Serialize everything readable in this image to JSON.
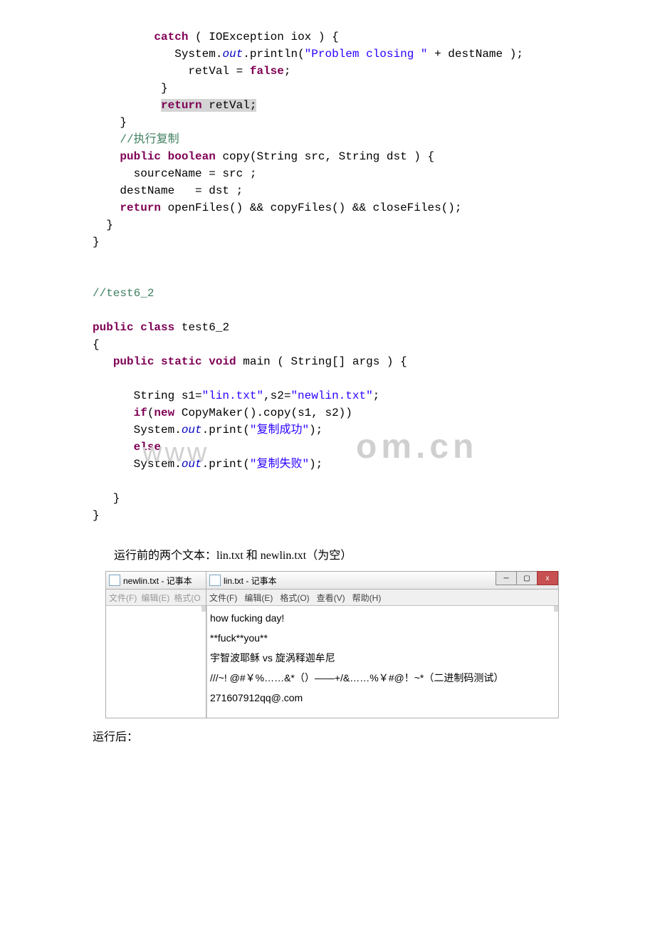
{
  "code1": {
    "l1a": "catch",
    "l1b": " ( IOException iox ) {",
    "l2a": "            System.",
    "l2b": "out",
    "l2c": ".println(",
    "l2d": "\"Problem closing \"",
    "l2e": " + destName );",
    "l3a": "              retVal = ",
    "l3b": "false",
    "l3c": ";",
    "l4": "          }",
    "l5a": "          ",
    "l5b": "return",
    "l5c": " retVal;",
    "l6": "    }",
    "l7": "    //执行复制",
    "l8a": "    ",
    "l8b": "public",
    "l8c": " ",
    "l8d": "boolean",
    "l8e": " copy(String src, String dst ) {",
    "l9": "      sourceName = src ;",
    "l10": "    destName   = dst ;",
    "l11a": "    ",
    "l11b": "return",
    "l11c": " openFiles() && copyFiles() && closeFiles();",
    "l12": "  }",
    "l13": "}"
  },
  "code2": {
    "l1": "//test6_2",
    "l2a": "public",
    "l2b": " ",
    "l2c": "class",
    "l2d": " test6_2",
    "l3": "{",
    "l4a": "   ",
    "l4b": "public",
    "l4c": " ",
    "l4d": "static",
    "l4e": " ",
    "l4f": "void",
    "l4g": " main ( String[] args ) {",
    "l5a": "      String s1=",
    "l5b": "\"lin.txt\"",
    "l5c": ",s2=",
    "l5d": "\"newlin.txt\"",
    "l5e": ";",
    "l6a": "      ",
    "l6b": "if",
    "l6c": "(",
    "l6d": "new",
    "l6e": " CopyMaker().copy(s1, s2))",
    "l7a": "      System.",
    "l7b": "out",
    "l7c": ".print(",
    "l7d": "\"复制成功\"",
    "l7e": ");",
    "l8a": "      ",
    "l8b": "else",
    "l9a": "      System.",
    "l9b": "out",
    "l9c": ".print(",
    "l9d": "\"复制失败\"",
    "l9e": ");",
    "l10": "   }",
    "l11": "}"
  },
  "heading1": "运行前的两个文本：lin.txt 和 newlin.txt（为空）",
  "heading2": "运行后：",
  "watermark1": "www",
  "watermark2": "om.cn",
  "notepad_left": {
    "title": "newlin.txt - 记事本",
    "menu": [
      "文件(F)",
      "编辑(E)",
      "格式(O"
    ]
  },
  "notepad_right": {
    "title": "lin.txt - 记事本",
    "menu": [
      "文件(F)",
      "编辑(E)",
      "格式(O)",
      "查看(V)",
      "帮助(H)"
    ],
    "content": [
      "how fucking day!",
      "**fuck**you**",
      "宇智波耶稣 vs 旋涡释迦牟尼",
      "///~! @#￥%……&*（）——+/&……%￥#@！~*（二进制码测试）",
      "271607912qq@.com"
    ]
  },
  "win_buttons": {
    "min": "─",
    "max": "▢",
    "close": "x"
  }
}
